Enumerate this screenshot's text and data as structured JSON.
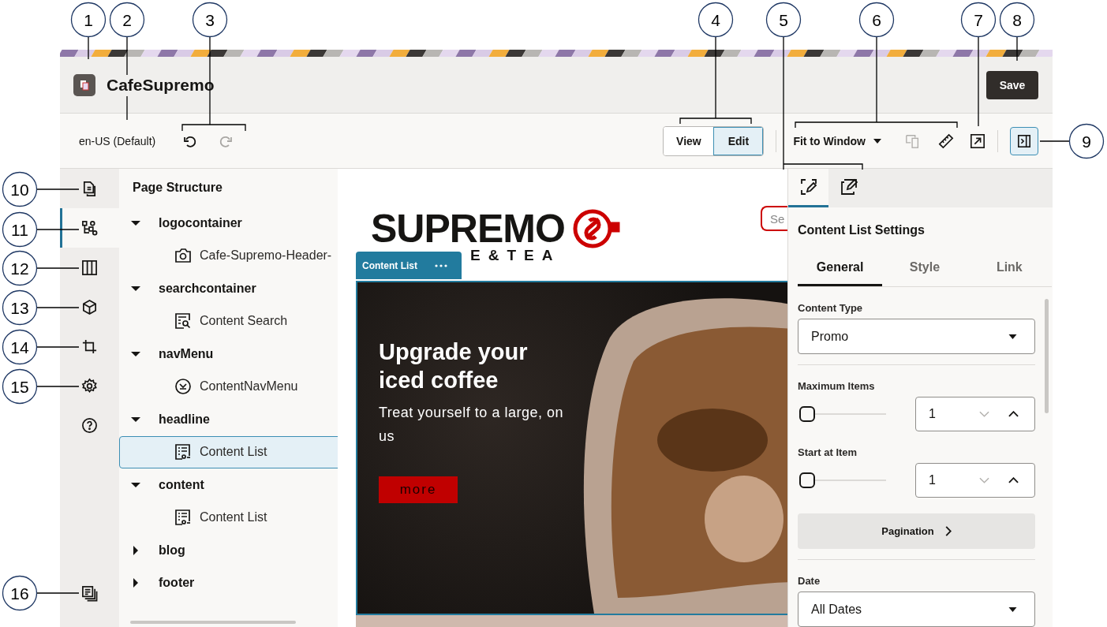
{
  "callouts": [
    {
      "label": "1"
    },
    {
      "label": "2"
    },
    {
      "label": "3"
    },
    {
      "label": "4"
    },
    {
      "label": "5"
    },
    {
      "label": "6"
    },
    {
      "label": "7"
    },
    {
      "label": "8"
    },
    {
      "label": "9"
    },
    {
      "label": "10"
    },
    {
      "label": "11"
    },
    {
      "label": "12"
    },
    {
      "label": "13"
    },
    {
      "label": "14"
    },
    {
      "label": "15"
    },
    {
      "label": "16"
    }
  ],
  "header": {
    "title": "CafeSupremo",
    "save_button": "Save"
  },
  "toolbar": {
    "locale": "en-US (Default)",
    "undo": {
      "disabled": false
    },
    "redo": {
      "disabled": true
    },
    "mode_toggle": [
      {
        "label": "View",
        "selected": false
      },
      {
        "label": "Edit",
        "selected": true
      }
    ],
    "zoom_select": "Fit to Window",
    "device_preview": {
      "disabled": true
    },
    "panel_toggle": {
      "on": true
    }
  },
  "rail": {
    "items": [
      {
        "kind": "document",
        "selected": false
      },
      {
        "kind": "tree",
        "selected": true
      },
      {
        "kind": "columns",
        "selected": false
      },
      {
        "kind": "cube",
        "selected": false
      },
      {
        "kind": "crop",
        "selected": false
      },
      {
        "kind": "gear",
        "selected": false
      },
      {
        "kind": "help",
        "selected": false
      }
    ],
    "bottom_items": [
      {
        "kind": "stack",
        "selected": false
      }
    ]
  },
  "page_structure": {
    "title": "Page Structure",
    "tree": [
      {
        "label": "logocontainer",
        "expanded": true,
        "children": [
          {
            "label": "Cafe-Supremo-Header-",
            "kind": "image",
            "selected": false
          }
        ]
      },
      {
        "label": "searchcontainer",
        "expanded": true,
        "children": [
          {
            "label": "Content Search",
            "kind": "search",
            "selected": false
          }
        ]
      },
      {
        "label": "navMenu",
        "expanded": true,
        "children": [
          {
            "label": "ContentNavMenu",
            "kind": "nav",
            "selected": false
          }
        ]
      },
      {
        "label": "headline",
        "expanded": true,
        "children": [
          {
            "label": "Content List",
            "kind": "list",
            "selected": true
          }
        ]
      },
      {
        "label": "content",
        "expanded": true,
        "children": [
          {
            "label": "Content List",
            "kind": "list",
            "selected": false
          }
        ]
      },
      {
        "label": "blog",
        "expanded": false
      },
      {
        "label": "footer",
        "expanded": false
      }
    ]
  },
  "canvas": {
    "logo": {
      "wordmark": "SUPREMO",
      "tagline": "E&TEA"
    },
    "search": {
      "placeholder": "Se"
    },
    "component_tag": {
      "label": "Content List"
    },
    "hero": {
      "title": "Upgrade your iced coffee",
      "subtitle": "Treat yourself to a large, on us",
      "button": "more"
    }
  },
  "settings_panel": {
    "icon_tabs": [
      {
        "kind": "frame-edit",
        "selected": true
      },
      {
        "kind": "stack-edit",
        "selected": false
      }
    ],
    "title": "Content List Settings",
    "tabs": [
      {
        "label": "General",
        "selected": true
      },
      {
        "label": "Style",
        "selected": false
      },
      {
        "label": "Link",
        "selected": false
      }
    ],
    "fields": [
      {
        "kind": "select",
        "label": "Content Type",
        "value": "Promo"
      },
      {
        "kind": "number",
        "label": "Maximum Items",
        "value": "1",
        "level": 0
      },
      {
        "kind": "number",
        "label": "Start at Item",
        "value": "1",
        "level": 0
      },
      {
        "kind": "button",
        "label": "Pagination"
      },
      {
        "kind": "select",
        "label": "Date",
        "value": "All Dates"
      }
    ]
  }
}
